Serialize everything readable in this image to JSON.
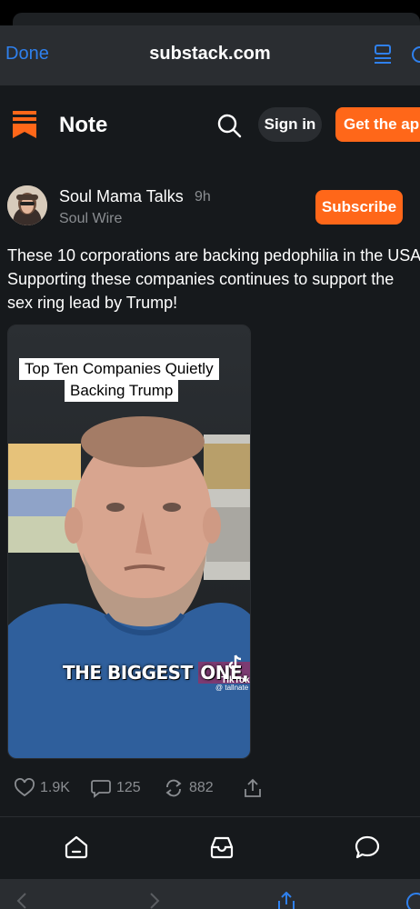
{
  "browser": {
    "done_label": "Done",
    "url": "substack.com"
  },
  "header": {
    "title": "Note",
    "signin_label": "Sign in",
    "getapp_label": "Get the app"
  },
  "post": {
    "author": "Soul Mama Talks",
    "time": "9h",
    "publication": "Soul Wire",
    "subscribe_label": "Subscribe",
    "body_lines": [
      "These 10 corporations are backing pedophilia in the USA.",
      "Supporting these companies continues to support the",
      "sex ring lead by Trump!"
    ]
  },
  "video": {
    "caption_line1": "Top Ten Companies Quietly",
    "caption_line2": "Backing Trump",
    "overlay_text_a": "THE BIGGEST ",
    "overlay_text_b": "ONE,",
    "tiktok_label": "TikTok",
    "tiktok_user": "@ tallnate"
  },
  "actions": {
    "likes": "1.9K",
    "comments": "125",
    "restacks": "882"
  },
  "colors": {
    "accent": "#ff6719",
    "link": "#2f80ed",
    "background": "#16191c",
    "muted": "#8a8d91"
  },
  "icons": {
    "logo": "substack-logo-icon",
    "search": "search-icon",
    "like": "heart-icon",
    "comment": "comment-icon",
    "restack": "restack-icon",
    "share": "share-icon",
    "home": "home-icon",
    "inbox": "inbox-icon",
    "chat": "chat-icon"
  }
}
